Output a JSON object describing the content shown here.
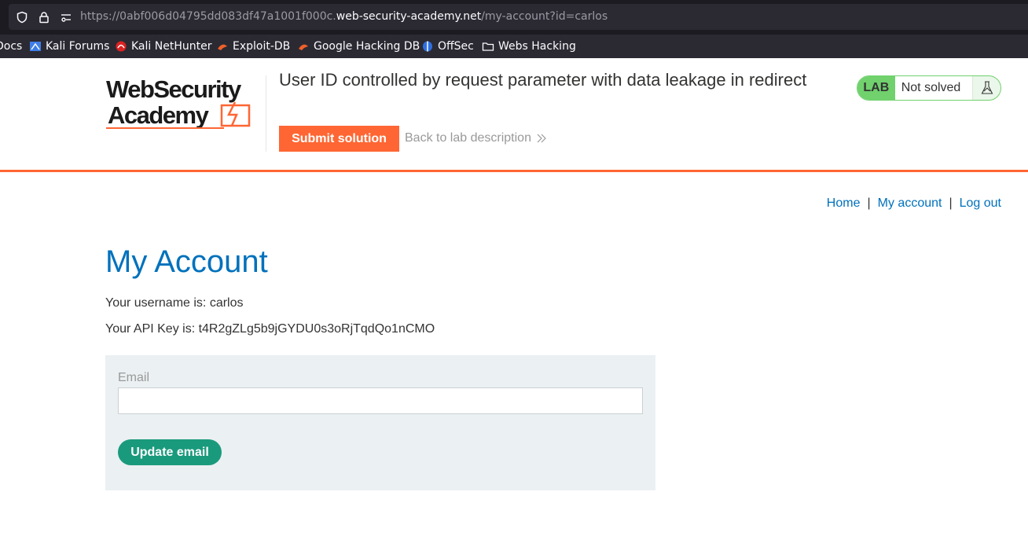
{
  "browser": {
    "url_prefix": "https://0abf006d04795dd083df47a1001f000c.",
    "url_host": "web-security-academy.net",
    "url_path": "/my-account?id=carlos",
    "bookmarks": [
      {
        "label": "Docs",
        "icon": "docs-icon"
      },
      {
        "label": "Kali Forums",
        "icon": "kali-forums-icon"
      },
      {
        "label": "Kali NetHunter",
        "icon": "kali-nethunter-icon"
      },
      {
        "label": "Exploit-DB",
        "icon": "exploit-db-icon"
      },
      {
        "label": "Google Hacking DB",
        "icon": "ghdb-icon"
      },
      {
        "label": "OffSec",
        "icon": "offsec-icon"
      },
      {
        "label": "Webs Hacking",
        "icon": "folder-icon"
      }
    ]
  },
  "lab": {
    "logo_line1": "WebSecurity",
    "logo_line2": "Academy",
    "title": "User ID controlled by request parameter with data leakage in redirect",
    "submit_label": "Submit solution",
    "back_label": "Back to lab description",
    "status_tag": "LAB",
    "status_text": "Not solved",
    "colors": {
      "accent": "#ff6633",
      "lab_green": "#70d16d"
    }
  },
  "nav": {
    "home": "Home",
    "my_account": "My account",
    "logout": "Log out",
    "separator": "|"
  },
  "main": {
    "title": "My Account",
    "username_line": "Your username is: carlos",
    "api_key_line": "Your API Key is: t4R2gZLg5b9jGYDU0s3oRjTqdQo1nCMO",
    "email_label": "Email",
    "email_value": "",
    "update_label": "Update email",
    "colors": {
      "title": "#0071bc",
      "button": "#1a9a7c"
    }
  }
}
